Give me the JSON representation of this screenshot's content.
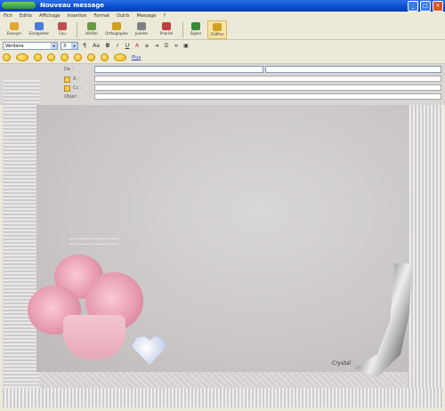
{
  "window": {
    "app_logo": "",
    "title": "Nouveau message",
    "minimize": "_",
    "maximize": "□",
    "close": "×"
  },
  "menu": [
    "Fich",
    "Editio",
    "Affichage",
    "Insertion",
    "Format",
    "Outils",
    "Message",
    "?"
  ],
  "toolbar": [
    {
      "label": "Envoyer",
      "icon": "send-icon",
      "color": "#e0a830"
    },
    {
      "label": "Enregistrer",
      "icon": "save-icon",
      "color": "#4a7bd8"
    },
    {
      "label": "Cou",
      "icon": "cut-icon",
      "color": "#c05050"
    },
    {
      "label": "Vérifier",
      "icon": "check-icon",
      "color": "#6a9a40"
    },
    {
      "label": "Orthographe",
      "icon": "spell-icon",
      "color": "#d0a020"
    },
    {
      "label": "Joindre",
      "icon": "attach-icon",
      "color": "#808080"
    },
    {
      "label": "Priorité",
      "icon": "priority-icon",
      "color": "#c04040"
    },
    {
      "label": "Signer",
      "icon": "sign-icon",
      "color": "#3a8a3a"
    },
    {
      "label": "Chiffrer",
      "icon": "encrypt-icon",
      "color": "#d0a020"
    }
  ],
  "format": {
    "font": "Verdana",
    "size": "3",
    "text_label": "Aa"
  },
  "smileys": {
    "link_label": "Plus"
  },
  "header": {
    "from_label": "De :",
    "stationery_value": "",
    "account_value": "",
    "to_label": "À :",
    "cc_label": "Cc :",
    "subject_label": "Objet :"
  },
  "message": {
    "signature": "Crystal"
  }
}
